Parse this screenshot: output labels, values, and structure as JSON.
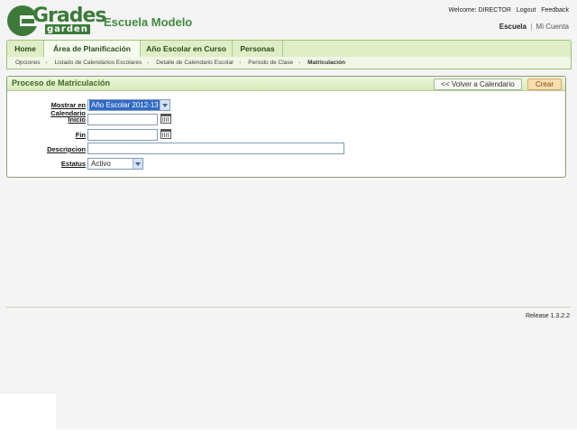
{
  "header": {
    "logo_top": "Grades",
    "logo_bottom": "garden",
    "school_name": "Escuela Modelo",
    "welcome": "Welcome: DIRECTOR",
    "logout": "Logout",
    "feedback": "Feedback",
    "context_school": "Escuela",
    "context_separator": "|",
    "context_account": "Mi Cuenta"
  },
  "nav": {
    "tabs": [
      {
        "label": "Home"
      },
      {
        "label": "Área de Planificación"
      },
      {
        "label": "Año Escolar en Curso"
      },
      {
        "label": "Personas"
      }
    ]
  },
  "breadcrumb": {
    "items": [
      "Opciones",
      "Listado de Calendarios Escolares",
      "Detalle de Calendario Escolar",
      "Periodo de Clase"
    ],
    "current": "Matriculación"
  },
  "panel": {
    "title": "Proceso de Matriculación",
    "back_button": "<< Volver a Calendario",
    "create_button": "Crear"
  },
  "form": {
    "mostrar_label": "Mostrar en Calendario",
    "mostrar_value": "Año Escolar 2012-13",
    "inicio_label": "Inicio",
    "inicio_value": "",
    "fin_label": "Fin",
    "fin_value": "",
    "descripcion_label": "Descripcion",
    "descripcion_value": "",
    "estatus_label": "Estatus",
    "estatus_value": "Activo"
  },
  "footer": {
    "release": "Release 1.3.2.2"
  },
  "colors": {
    "brand_green": "#3d7a3a",
    "nav_bg": "#dfeec6",
    "create_button_bg": "#f9ddb0",
    "select_highlight": "#316ac5"
  }
}
